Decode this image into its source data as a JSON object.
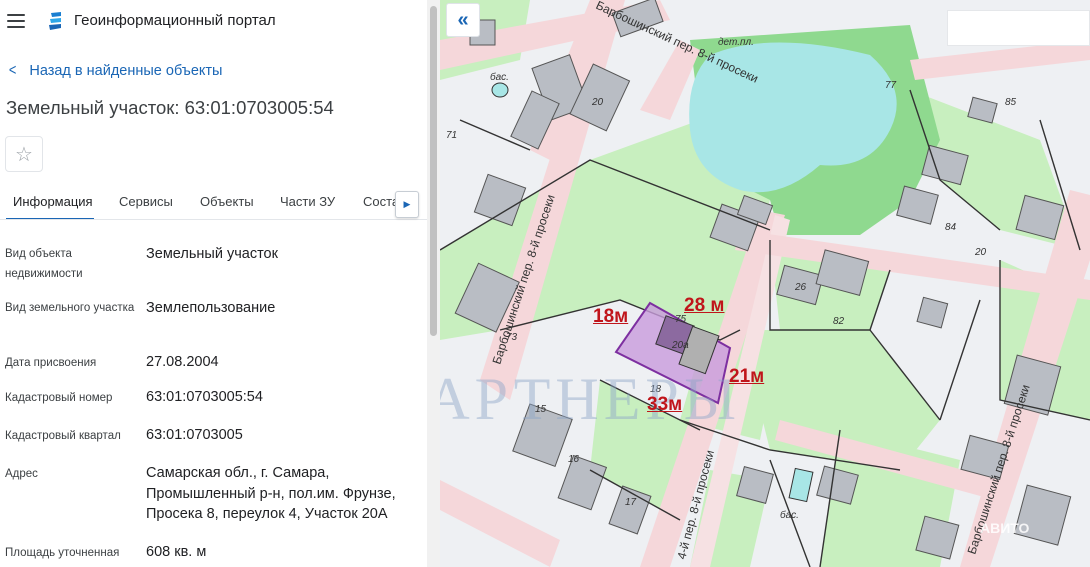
{
  "app": {
    "title": "Геоинформационный портал"
  },
  "nav": {
    "back_label": "Назад в найденные объекты"
  },
  "object": {
    "title": "Земельный участок: 63:01:0703005:54"
  },
  "tabs": [
    "Информация",
    "Сервисы",
    "Объекты",
    "Части ЗУ",
    "Соста"
  ],
  "info": [
    {
      "label": "Вид объекта недвижимости",
      "value": "Земельный участок"
    },
    {
      "label": "Вид земельного участка",
      "value": "Землепользование"
    },
    {
      "label": "Дата присвоения",
      "value": "27.08.2004"
    },
    {
      "label": "Кадастровый номер",
      "value": "63:01:0703005:54"
    },
    {
      "label": "Кадастровый квартал",
      "value": "63:01:0703005"
    },
    {
      "label": "Адрес",
      "value": "Самарская обл., г. Самара, Промышленный р-н, пол.им. Фрунзе, Просека 8, переулок 4, Участок 20А"
    },
    {
      "label": "Площадь уточненная",
      "value": "608 кв. м"
    }
  ],
  "map": {
    "measurements": [
      "18м",
      "28 м",
      "21м",
      "33м"
    ],
    "streets": [
      "Барбошинский пер. 8-й просеки",
      "Барбошинский пер. 8-й просеки",
      "4-й пер. 8-й просеки",
      "Барбошинский пер. 8-й просеки"
    ],
    "labels": [
      "дет.пл.",
      "бас.",
      "бас.",
      "77",
      "85",
      "71",
      "20",
      "20",
      "26",
      "82",
      "84",
      "15",
      "16",
      "17",
      "18",
      "73",
      "75",
      "20а"
    ],
    "watermark": "ПАРТНЕРЫ",
    "corner_text": "АВИТО",
    "colors": {
      "accent": "#1a66b5",
      "measure": "#c0151b",
      "water": "#a8e6e6",
      "green": "#b9eab0",
      "road": "#f5d7da",
      "parcel": "#b36ad6"
    }
  }
}
